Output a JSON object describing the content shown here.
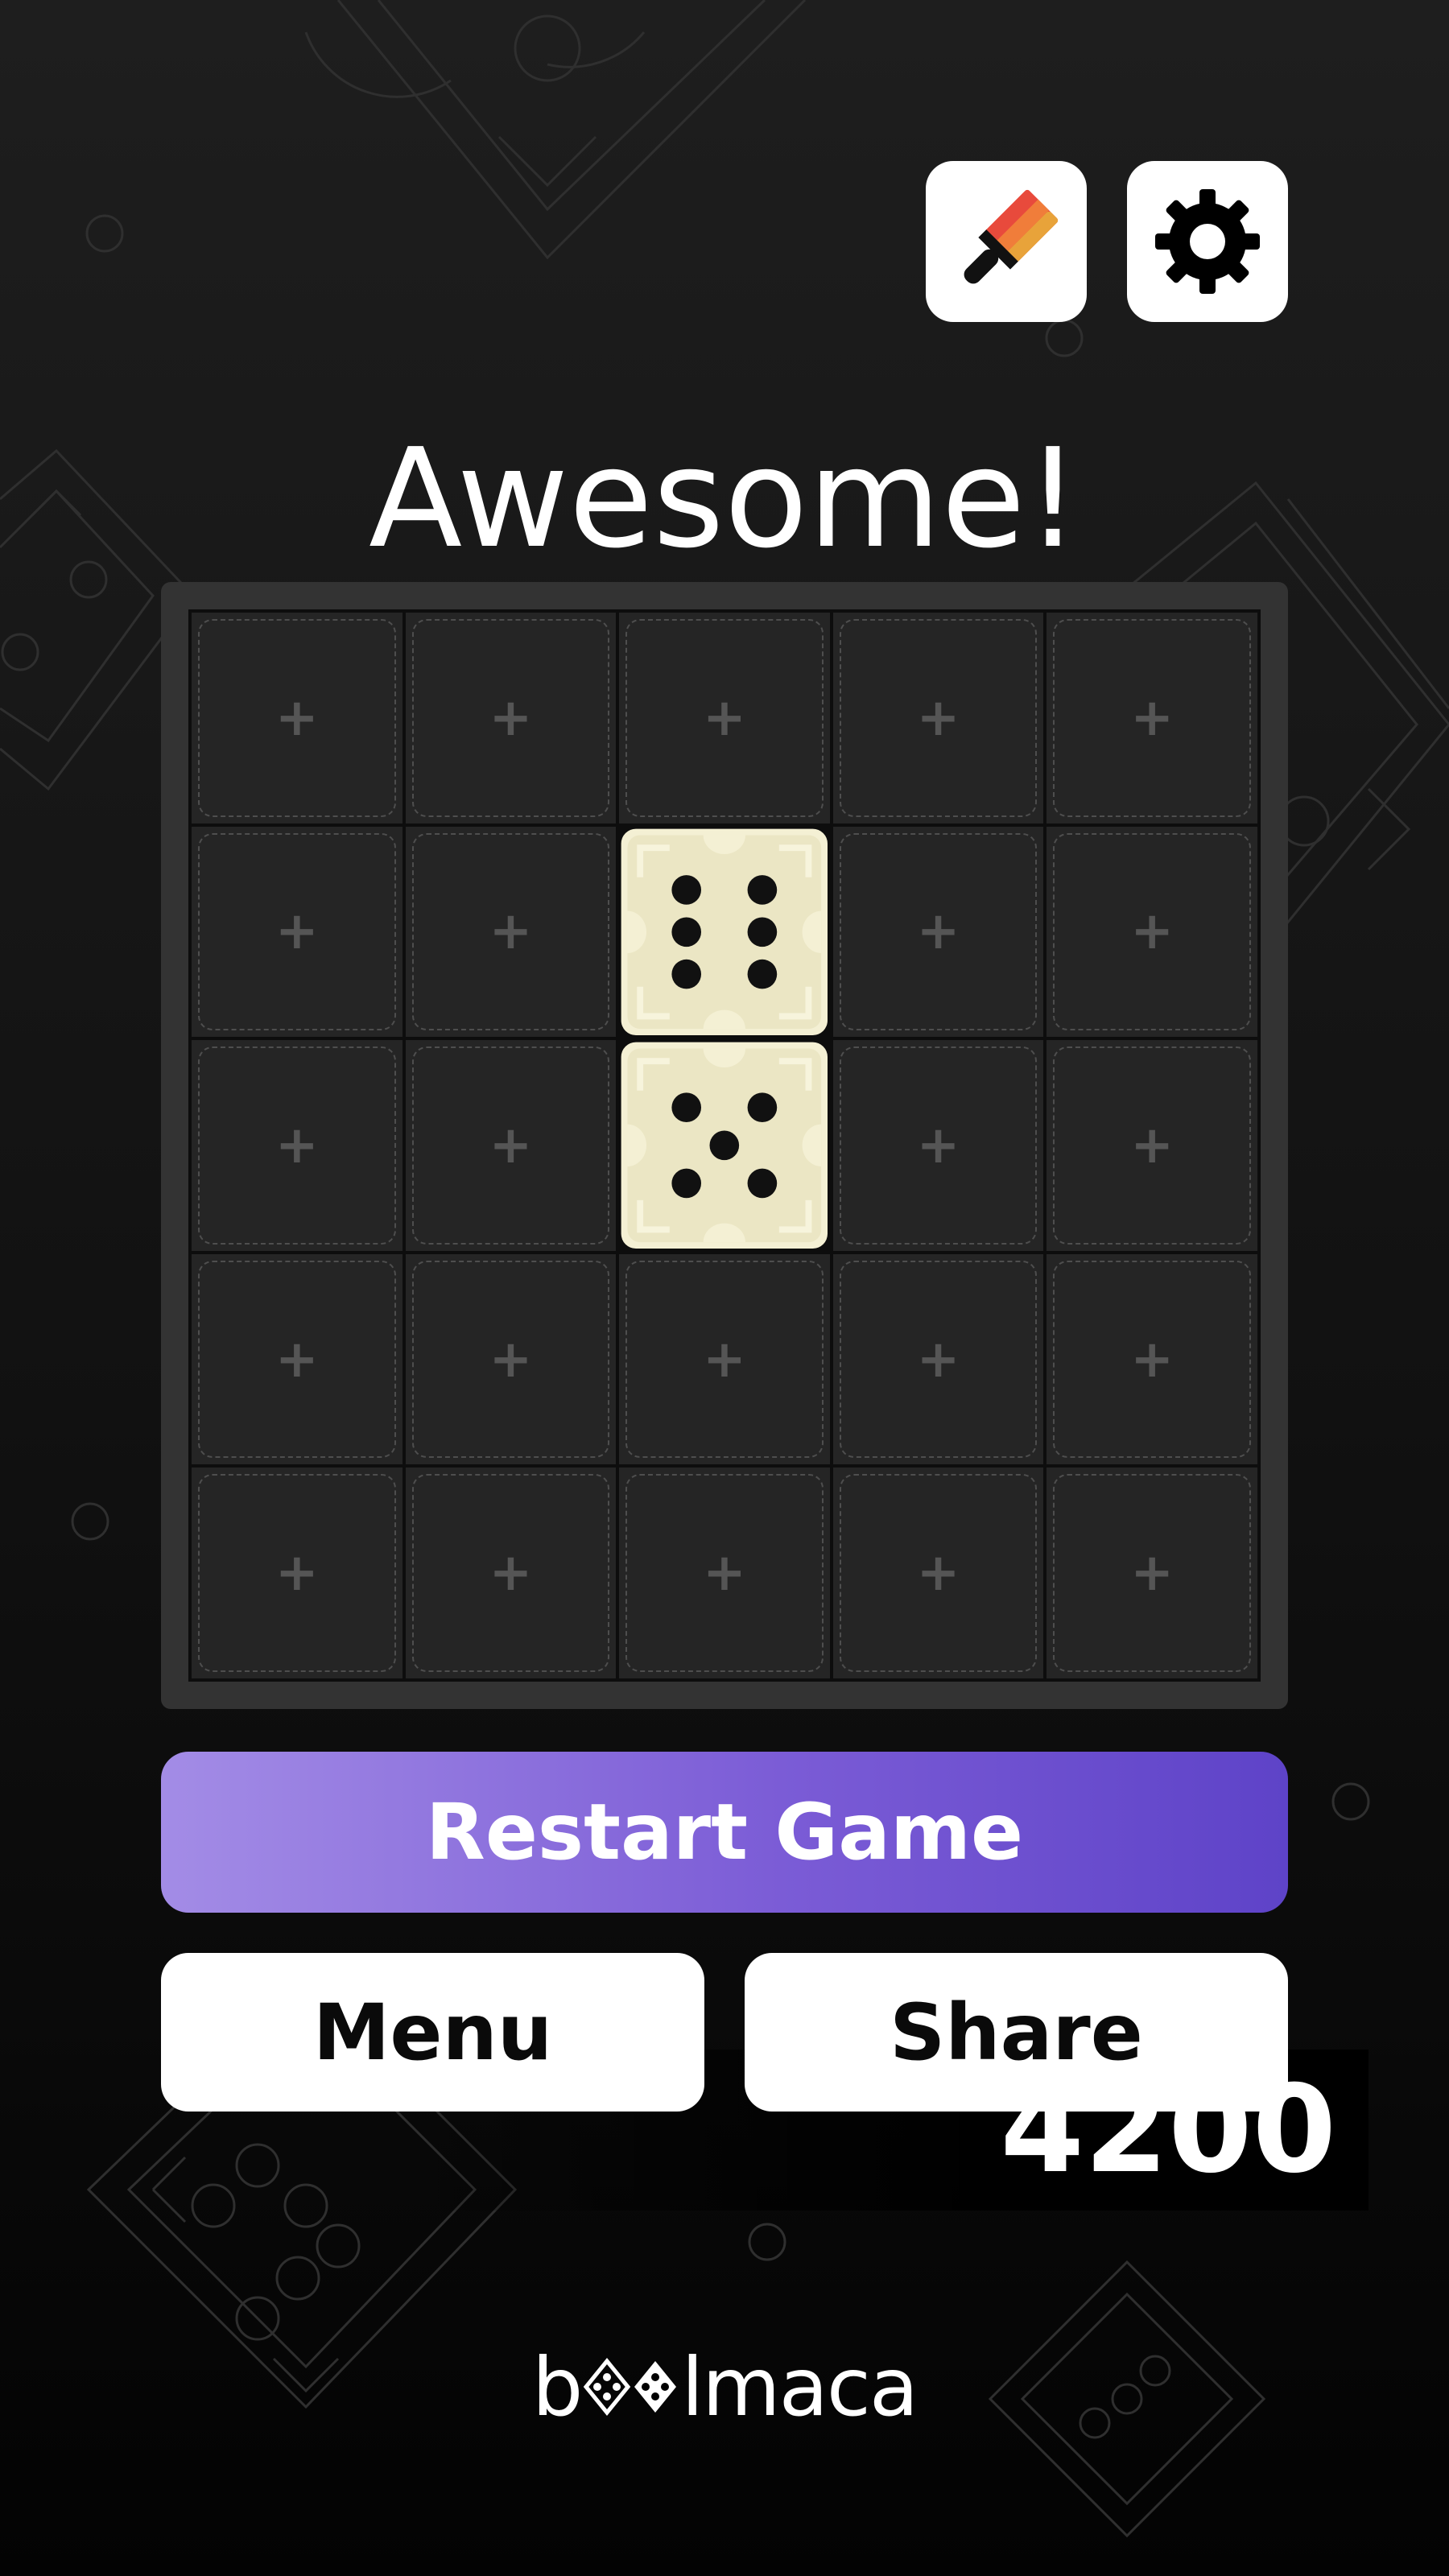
{
  "header": {
    "theme_button": {
      "icon": "paintbrush-icon"
    },
    "settings_button": {
      "icon": "gear-icon"
    }
  },
  "title": "Awesome!",
  "board": {
    "rows": 5,
    "cols": 5,
    "empty_cell_symbol": "+",
    "dice": [
      {
        "row": 2,
        "col": 3,
        "pips": 6
      },
      {
        "row": 3,
        "col": 3,
        "pips": 5
      }
    ]
  },
  "score": "4200",
  "buttons": {
    "restart": "Restart Game",
    "menu": "Menu",
    "share": "Share"
  },
  "brand": {
    "prefix": "b",
    "suffix": "lmaca",
    "icon": "dice-logo-icon"
  },
  "colors": {
    "accent_gradient_start": "#a38ce6",
    "accent_gradient_end": "#5e43c8",
    "die_face": "#ebe6c4",
    "die_border": "#f4f0d4"
  }
}
